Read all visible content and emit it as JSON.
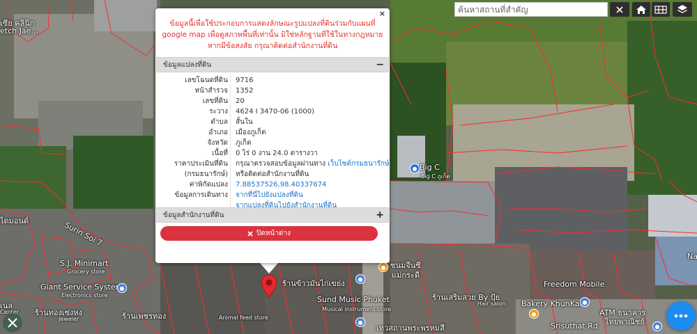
{
  "search": {
    "placeholder": "ค้นหาสถานที่สำคัญ",
    "clear_icon": "close-icon"
  },
  "controls": {
    "home_icon": "home-icon",
    "grid_icon": "grid-icon",
    "layers_icon": "layers-icon"
  },
  "popup": {
    "close_label": "×",
    "disclaimer": "ข้อมูลนี้เพื่อใช้ประกอบการแสดงลักษณะรูปแปลงที่ดินร่วมกับแผนที่ google map เพื่อดูสภาพพื้นที่เท่านั้น มิใช่หลักฐานที่ใช้ในทางกฎหมาย หากมีข้อสงสัย กรุณาติดต่อสำนักงานที่ดิน",
    "section1_title": "ข้อมูลแปลงที่ดิน",
    "section1_toggle": "−",
    "section2_title": "ข้อมูลสำนักงานที่ดิน",
    "section2_toggle": "+",
    "rows": [
      {
        "label": "เลขโฉนดที่ดิน",
        "value": "9716"
      },
      {
        "label": "หน้าสำรวจ",
        "value": "1352"
      },
      {
        "label": "เลขที่ดิน",
        "value": "20"
      },
      {
        "label": "ระวาง",
        "value": "4624 I 3470-06 (1000)"
      },
      {
        "label": "ตำบล",
        "value": "สั้นใน"
      },
      {
        "label": "อำเภอ",
        "value": "เมืองภูเก็ต"
      },
      {
        "label": "จังหวัด",
        "value": "ภูเก็ต"
      },
      {
        "label": "เนื้อที่",
        "value": "0 ไร่ 0 งาน 24.0 ตารางวา"
      }
    ],
    "price_label_1": "ราคาประเมินที่ดิน",
    "price_label_2": "(กรมธนารักษ์)",
    "price_value_1": "กรุณาตรวจสอบข้อมูลผ่านทาง",
    "price_link": "เว็บไซต์กรมธนารักษ์",
    "price_value_2": "หรือติดต่อสำนักงานที่ดิน",
    "coord_label": "ค่าพิกัดแปลง",
    "coord_value": "7.88537526,98.40337674",
    "travel_label": "ข้อมูลการเดินทาง",
    "travel_link_1": "จากที่นี่ไปยังแปลงที่ดิน",
    "travel_link_2": "จากแปลงที่ดินไปยังสำนักงานที่ดิน",
    "close_window_label": "ปิดหน้าต่าง"
  },
  "map_labels": {
    "clinic": "เซีย คลินิก",
    "clinic_en": "etch Jae...",
    "big_c": "Big C",
    "big_c_sub": "Big C ภูเก็ต",
    "surin_soi": "Surin Soi 7",
    "diamond": "ไดมอนด์",
    "sj_minimart": "S.J. Minimart",
    "grocery": "Grocery store",
    "giant": "Giant Service System",
    "electronics": "Electronics store",
    "jeweler": "Jeweler",
    "gold": "ร้านทองเซ่งหง",
    "gold2": "ร้านเพชรทอง",
    "sund": "Sund Music Phuket",
    "sund_sub": "Musical instrument store",
    "animal": "Animal feed store",
    "shop1": "ร้านข้าวมันไก่เขย่ง",
    "shop2": "ร้านเสริมสวย By ปุ้ย",
    "hair": "Hair salon",
    "freedom": "Freedom Mobile",
    "bakery": "Bakery KhunKai",
    "atm": "ATM ธนาคาร",
    "atm2": "ไทยพาณิชย์",
    "srisuthat": "Srisuthat Rd",
    "nachon": "ชนมจีนซี",
    "nachon2": "แม่กระดี",
    "tewasthan": "เทวสถานพระพรหมสี",
    "left_label": "เนล",
    "left_label2": "Center",
    "right_na": "Na"
  }
}
